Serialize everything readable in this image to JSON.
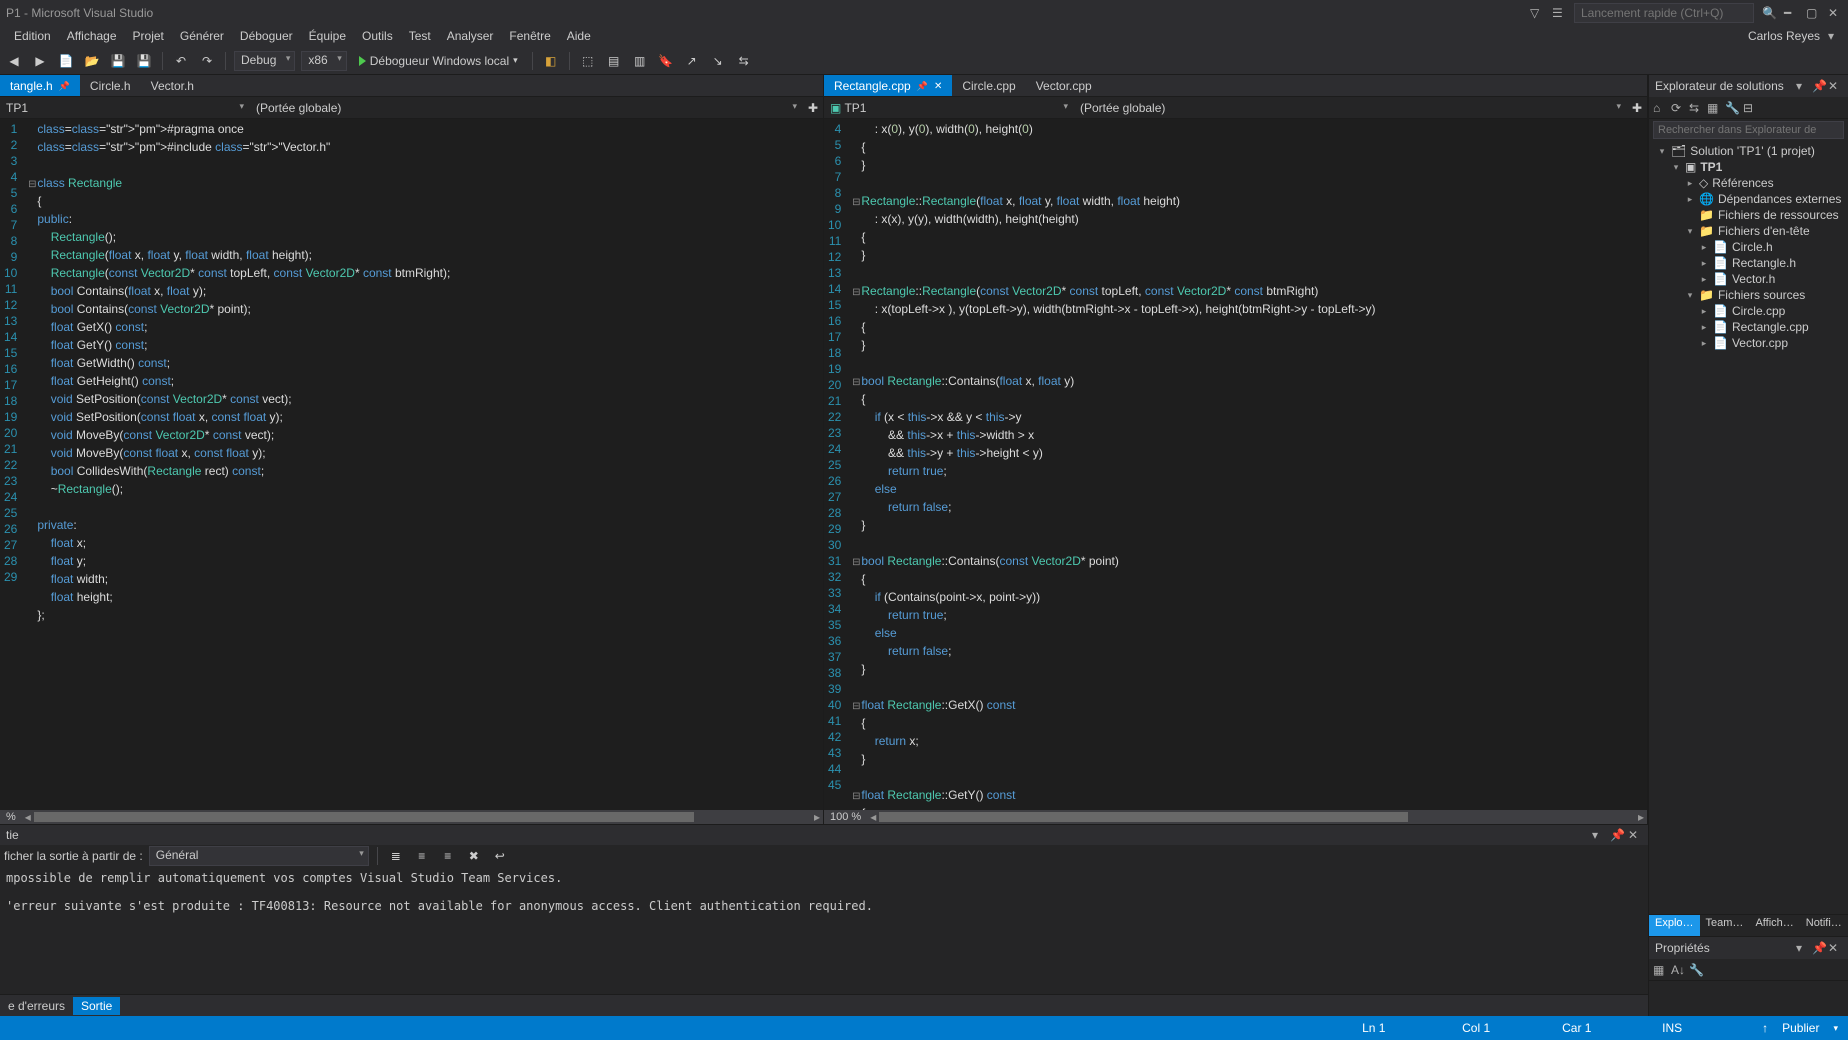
{
  "titlebar": {
    "title": "P1 - Microsoft Visual Studio"
  },
  "quicklaunch": {
    "placeholder": "Lancement rapide (Ctrl+Q)"
  },
  "user": {
    "name": "Carlos Reyes"
  },
  "menu": [
    "Edition",
    "Affichage",
    "Projet",
    "Générer",
    "Déboguer",
    "Équipe",
    "Outils",
    "Test",
    "Analyser",
    "Fenêtre",
    "Aide"
  ],
  "toolbar": {
    "config": "Debug",
    "platform": "x86",
    "run_label": "Débogueur Windows local"
  },
  "left_pane": {
    "tabs": [
      {
        "label": "tangle.h",
        "active": true,
        "pin": true
      },
      {
        "label": "Circle.h"
      },
      {
        "label": "Vector.h"
      }
    ],
    "dd_left": "TP1",
    "dd_right": "(Portée globale)",
    "zoom": "%",
    "lines": [
      {
        "n": 1,
        "t": "cmt",
        "txt": "#pragma once"
      },
      {
        "n": 2,
        "t": "inc",
        "txt": "#include \"Vector.h\""
      },
      {
        "n": 3,
        "txt": ""
      },
      {
        "n": 4,
        "fold": true,
        "txt": "class Rectangle"
      },
      {
        "n": 5,
        "txt": "{"
      },
      {
        "n": 6,
        "txt": "public:"
      },
      {
        "n": 7,
        "txt": "    Rectangle();"
      },
      {
        "n": 8,
        "txt": "    Rectangle(float x, float y, float width, float height);"
      },
      {
        "n": 9,
        "txt": "    Rectangle(const Vector2D* const topLeft, const Vector2D* const btmRight);"
      },
      {
        "n": 10,
        "txt": "    bool Contains(float x, float y);"
      },
      {
        "n": 11,
        "txt": "    bool Contains(const Vector2D* point);"
      },
      {
        "n": 12,
        "txt": "    float GetX() const;"
      },
      {
        "n": 13,
        "txt": "    float GetY() const;"
      },
      {
        "n": 14,
        "txt": "    float GetWidth() const;"
      },
      {
        "n": 15,
        "txt": "    float GetHeight() const;"
      },
      {
        "n": 16,
        "txt": "    void SetPosition(const Vector2D* const vect);"
      },
      {
        "n": 17,
        "txt": "    void SetPosition(const float x, const float y);"
      },
      {
        "n": 18,
        "txt": "    void MoveBy(const Vector2D* const vect);"
      },
      {
        "n": 19,
        "txt": "    void MoveBy(const float x, const float y);"
      },
      {
        "n": 20,
        "txt": "    bool CollidesWith(Rectangle rect) const;"
      },
      {
        "n": 21,
        "txt": "    ~Rectangle();"
      },
      {
        "n": 22,
        "txt": ""
      },
      {
        "n": 23,
        "txt": "private:"
      },
      {
        "n": 24,
        "txt": "    float x;"
      },
      {
        "n": 25,
        "txt": "    float y;"
      },
      {
        "n": 26,
        "txt": "    float width;"
      },
      {
        "n": 27,
        "txt": "    float height;"
      },
      {
        "n": 28,
        "txt": "};"
      },
      {
        "n": 29,
        "txt": ""
      }
    ]
  },
  "right_pane": {
    "tabs": [
      {
        "label": "Rectangle.cpp",
        "active": true,
        "pin": true,
        "close": true
      },
      {
        "label": "Circle.cpp"
      },
      {
        "label": "Vector.cpp"
      }
    ],
    "dd_left": "TP1",
    "dd_right": "(Portée globale)",
    "zoom": "100 %",
    "lines": [
      {
        "n": 4,
        "txt": "    : x(0), y(0), width(0), height(0)"
      },
      {
        "n": 5,
        "txt": "{"
      },
      {
        "n": 6,
        "txt": "}"
      },
      {
        "n": 7,
        "txt": ""
      },
      {
        "n": 8,
        "fold": true,
        "txt": "Rectangle::Rectangle(float x, float y, float width, float height)"
      },
      {
        "n": 9,
        "txt": "    : x(x), y(y), width(width), height(height)"
      },
      {
        "n": 10,
        "txt": "{"
      },
      {
        "n": 11,
        "txt": "}"
      },
      {
        "n": 12,
        "txt": ""
      },
      {
        "n": 13,
        "fold": true,
        "txt": "Rectangle::Rectangle(const Vector2D* const topLeft, const Vector2D* const btmRight)"
      },
      {
        "n": 14,
        "txt": "    : x(topLeft->x ), y(topLeft->y), width(btmRight->x - topLeft->x), height(btmRight->y - topLeft->y)"
      },
      {
        "n": 15,
        "txt": "{"
      },
      {
        "n": 16,
        "txt": "}"
      },
      {
        "n": 17,
        "txt": ""
      },
      {
        "n": 18,
        "fold": true,
        "txt": "bool Rectangle::Contains(float x, float y)"
      },
      {
        "n": 19,
        "txt": "{"
      },
      {
        "n": 20,
        "txt": "    if (x < this->x && y < this->y"
      },
      {
        "n": 21,
        "txt": "        && this->x + this->width > x"
      },
      {
        "n": 22,
        "txt": "        && this->y + this->height < y)"
      },
      {
        "n": 23,
        "txt": "        return true;"
      },
      {
        "n": 24,
        "txt": "    else"
      },
      {
        "n": 25,
        "txt": "        return false;"
      },
      {
        "n": 26,
        "txt": "}"
      },
      {
        "n": 27,
        "txt": ""
      },
      {
        "n": 28,
        "fold": true,
        "txt": "bool Rectangle::Contains(const Vector2D* point)"
      },
      {
        "n": 29,
        "txt": "{"
      },
      {
        "n": 30,
        "txt": "    if (Contains(point->x, point->y))"
      },
      {
        "n": 31,
        "txt": "        return true;"
      },
      {
        "n": 32,
        "txt": "    else"
      },
      {
        "n": 33,
        "txt": "        return false;"
      },
      {
        "n": 34,
        "txt": "}"
      },
      {
        "n": 35,
        "txt": ""
      },
      {
        "n": 36,
        "fold": true,
        "txt": "float Rectangle::GetX() const"
      },
      {
        "n": 37,
        "txt": "{"
      },
      {
        "n": 38,
        "txt": "    return x;"
      },
      {
        "n": 39,
        "txt": "}"
      },
      {
        "n": 40,
        "txt": ""
      },
      {
        "n": 41,
        "fold": true,
        "txt": "float Rectangle::GetY() const"
      },
      {
        "n": 42,
        "txt": "{"
      },
      {
        "n": 43,
        "txt": "    return y;"
      },
      {
        "n": 44,
        "txt": "}"
      },
      {
        "n": 45,
        "txt": ""
      }
    ]
  },
  "output": {
    "title": "tie",
    "filter_label": "ficher la sortie à partir de :",
    "filter_value": "Général",
    "lines": [
      "mpossible de remplir automatiquement vos comptes Visual Studio Team Services.",
      "",
      "'erreur suivante s'est produite : TF400813: Resource not available for anonymous access. Client authentication required."
    ]
  },
  "bottom_tabs": [
    {
      "label": "e d'erreurs"
    },
    {
      "label": "Sortie",
      "active": true
    }
  ],
  "status": {
    "ln": "Ln 1",
    "col": "Col 1",
    "car": "Car 1",
    "ins": "INS",
    "publish": "Publier"
  },
  "solution_explorer": {
    "title": "Explorateur de solutions",
    "search_placeholder": "Rechercher dans Explorateur de",
    "tree": [
      {
        "d": 0,
        "arw": "▾",
        "icon": "🗂",
        "label": "Solution 'TP1' (1 projet)"
      },
      {
        "d": 1,
        "arw": "▾",
        "icon": "▣",
        "label": "TP1",
        "bold": true
      },
      {
        "d": 2,
        "arw": "▸",
        "icon": "◇",
        "label": "Références"
      },
      {
        "d": 2,
        "arw": "▸",
        "icon": "🌐",
        "label": "Dépendances externes"
      },
      {
        "d": 2,
        "arw": "",
        "icon": "📁",
        "label": "Fichiers de ressources"
      },
      {
        "d": 2,
        "arw": "▾",
        "icon": "📁",
        "label": "Fichiers d'en-tête"
      },
      {
        "d": 3,
        "arw": "▸",
        "icon": "📄",
        "label": "Circle.h"
      },
      {
        "d": 3,
        "arw": "▸",
        "icon": "📄",
        "label": "Rectangle.h"
      },
      {
        "d": 3,
        "arw": "▸",
        "icon": "📄",
        "label": "Vector.h"
      },
      {
        "d": 2,
        "arw": "▾",
        "icon": "📁",
        "label": "Fichiers sources"
      },
      {
        "d": 3,
        "arw": "▸",
        "icon": "📄",
        "label": "Circle.cpp"
      },
      {
        "d": 3,
        "arw": "▸",
        "icon": "📄",
        "label": "Rectangle.cpp"
      },
      {
        "d": 3,
        "arw": "▸",
        "icon": "📄",
        "label": "Vector.cpp"
      }
    ],
    "tabs": [
      "Explo…",
      "Team…",
      "Affich…",
      "Notifi…"
    ]
  },
  "properties": {
    "title": "Propriétés"
  }
}
